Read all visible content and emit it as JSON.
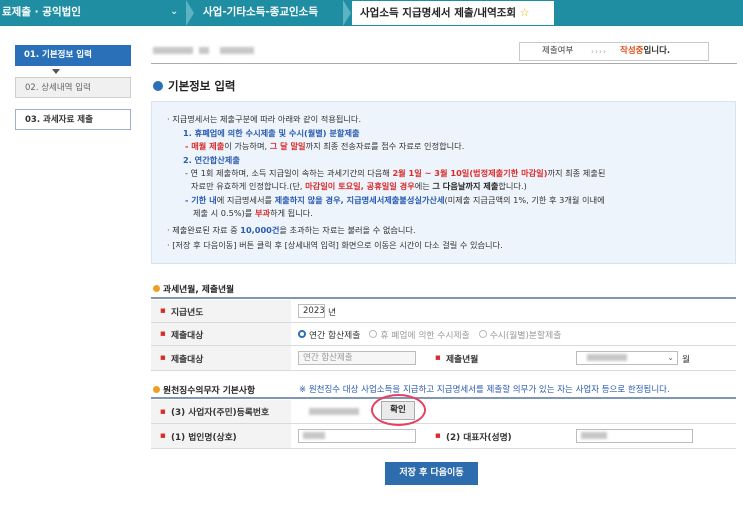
{
  "breadcrumb": {
    "item1": "료제출 · 공익법인",
    "item2": "사업-기타소득-종교인소득",
    "item3": "사업소득 지급명세서 제출/내역조회",
    "star_icon": "star-icon"
  },
  "steps": [
    {
      "label": "01. 기본정보 입력"
    },
    {
      "label": "02. 상세내역 입력"
    },
    {
      "label": "03. 과세자료 제출"
    }
  ],
  "status": {
    "label": "제출여부",
    "arrows": "››››",
    "value": "작성중",
    "suffix": "입니다."
  },
  "section_title": "기본정보 입력",
  "info": {
    "l1": "· 지급명세서는 제출구분에 따라 아래와 같이 적용됩니다.",
    "l2": "1. 휴폐업에 의한 수시제출 및 수시(월별) 분할제출",
    "l3a": "- 매월 제출",
    "l3b": "이 가능하며, ",
    "l3c": "그 달 말일",
    "l3d": "까지 최종 전송자료를 접수 자료로 인정합니다.",
    "l4": "2. 연간합산제출",
    "l5a": "- 연 1회 제출하며, 소득 지급일이 속하는 과세기간의 다음해 ",
    "l5b": "2월 1일 ~ 3월 10일(법정제출기한 마감일)",
    "l5c": "까지 최종 제출된",
    "l6a": "자료만 유효하게 인정합니다.(단, ",
    "l6b": "마감일이 토요일, 공휴일일 경우",
    "l6c": "에는 ",
    "l6d": "그 다음날까지 제출",
    "l6e": "합니다.)",
    "l7a": "- 기한 내",
    "l7b": "에 지급명세서를 ",
    "l7c": "제출하지 않을 경우, 지급명세서제출불성실가산세",
    "l7d": "(미제출 지급금액의 1%, 기한 후 3개월 이내에",
    "l8a": "제출 시 0.5%)를 ",
    "l8b": "부과",
    "l8c": "하게 됩니다.",
    "l9a": "· 제출완료된 자료 중 ",
    "l9b": "10,000건",
    "l9c": "을 초과하는 자료는 불러올 수 없습니다.",
    "l10": "· [저장 후 다음이동] 버튼 클릭 후 [상세내역 입력] 화면으로 이동은 시간이 다소 걸릴 수 있습니다."
  },
  "section2": {
    "title": "과세년월, 제출년월",
    "rows": {
      "pay_year_label": "지급년도",
      "pay_year_value": "2023",
      "pay_year_unit": "년",
      "target_label": "제출대상",
      "opt1": "연간 합산제출",
      "opt2": "휴 폐업에 의한 수시제출",
      "opt3": "수시(월별)분할제출",
      "target2_label": "제출대상",
      "target2_value": "연간 합산제출",
      "submit_month_label": "제출년월",
      "submit_month_unit": "월"
    }
  },
  "section3": {
    "title": "원천징수의무자 기본사항",
    "note": "※ 원천징수 대상 사업소득을 지급하고 지급명세서를 제출할 의무가 있는 자는 사업자 등으로 한정됩니다.",
    "bizno_label": "(3) 사업자(주민)등록번호",
    "confirm": "확인",
    "corp_label": "(1) 법인명(상호)",
    "rep_label": "(2) 대표자(성명)"
  },
  "save_button": "저장 후 다음이동",
  "colors": {
    "topbar": "#1f8ea3",
    "primary": "#2970b8",
    "accent_red": "#d92c2c",
    "highlight_circle": "#e8415f"
  }
}
